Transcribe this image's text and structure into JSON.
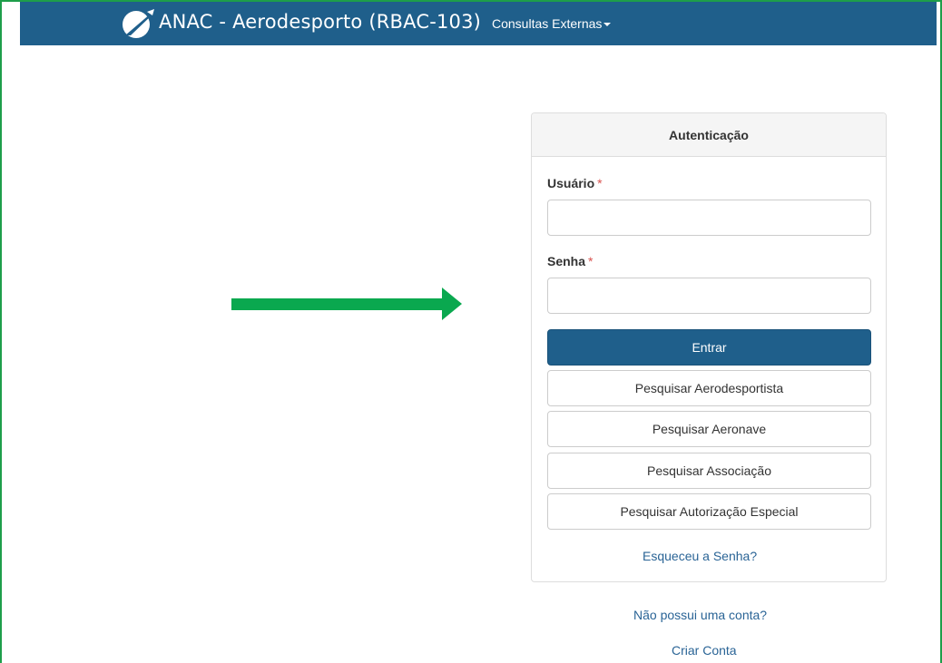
{
  "navbar": {
    "brand": "ANAC - Aerodesporto (RBAC-103)",
    "menu_label": "Consultas Externas",
    "logo_icon": "airplane-logo-icon",
    "background": "#1f5f8b"
  },
  "auth_panel": {
    "heading": "Autenticação",
    "user_label": "Usuário",
    "password_label": "Senha",
    "required_mark": "*",
    "user_value": "",
    "password_value": "",
    "login_button": "Entrar",
    "actions": [
      "Pesquisar Aerodesportista",
      "Pesquisar Aeronave",
      "Pesquisar Associação",
      "Pesquisar Autorização Especial"
    ],
    "forgot_password": "Esqueceu a Senha?"
  },
  "footer_links": {
    "no_account": "Não possui uma conta?",
    "create_account": "Criar Conta"
  },
  "annotation": {
    "icon": "green-arrow-right-icon",
    "color": "#0aa84f"
  },
  "colors": {
    "primary": "#1f5f8b",
    "required": "#d9534f",
    "link": "#2a6496",
    "frame": "#1e9e4a"
  }
}
